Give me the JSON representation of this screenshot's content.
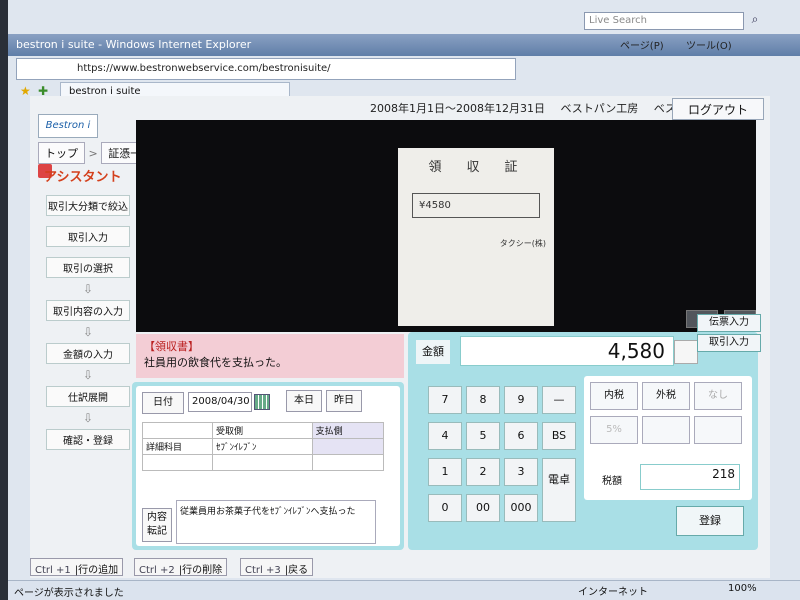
{
  "browser": {
    "window_title": "bestron i suite - Windows Internet Explorer",
    "url": "https://www.bestronwebservice.com/bestronisuite/",
    "tab_title": "bestron i suite",
    "search_placeholder": "Live Search",
    "page_menu": "ページ(P)",
    "tools_menu": "ツール(O)",
    "status_text": "ページが表示されました",
    "zone": "インターネット",
    "zoom": "100%"
  },
  "header": {
    "period": "2008年1月1日～2008年12月31日",
    "company": "ベストパン工房",
    "user": "ベスト管理者　様",
    "logout": "ログアウト",
    "logo": "Bestron i Suite"
  },
  "breadcrumb": {
    "top": "トップ",
    "current": "証憑一覧／証憑登録"
  },
  "sidebar": {
    "title": "アシスタント",
    "items": [
      "取引大分類で絞込",
      "取引入力",
      "取引の選択",
      "取引内容の入力",
      "金額の入力",
      "仕訳展開",
      "確認・登録"
    ]
  },
  "receipt": {
    "title": "領　収　証",
    "amount": "¥4580",
    "issuer": "タクシー(株)"
  },
  "document": {
    "type": "【領収書】",
    "description": "社員用の飲食代を支払った。"
  },
  "form": {
    "date_label": "日付",
    "date_value": "2008/04/30",
    "today": "本日",
    "yesterday": "昨日",
    "col_receiver": "受取側",
    "col_payer": "支払側",
    "row_label": "詳細科目",
    "row_value": "ｾﾌﾞﾝｲﾚﾌﾞﾝ",
    "memo_button": "内容転記",
    "memo_text": "従業員用お茶菓子代をｾﾌﾞﾝｲﾚﾌﾞﾝへ支払った"
  },
  "amount": {
    "label": "金額",
    "value": "4,580",
    "voucher_input": "伝票入力",
    "transaction_input": "取引入力",
    "keys": [
      "7",
      "8",
      "9",
      "—",
      "4",
      "5",
      "6",
      "BS",
      "1",
      "2",
      "3",
      "0",
      "00",
      "000"
    ],
    "calculator": "電卓",
    "tax_inclusive": "内税",
    "tax_exclusive": "外税",
    "tax_none": "なし",
    "tax_rate": "5%",
    "tax_label": "税額",
    "tax_value": "218",
    "register": "登録"
  },
  "shortcuts": [
    {
      "key": "Ctrl +1",
      "label": "行の追加"
    },
    {
      "key": "Ctrl +2",
      "label": "行の削除"
    },
    {
      "key": "Ctrl +3",
      "label": "戻る"
    }
  ]
}
